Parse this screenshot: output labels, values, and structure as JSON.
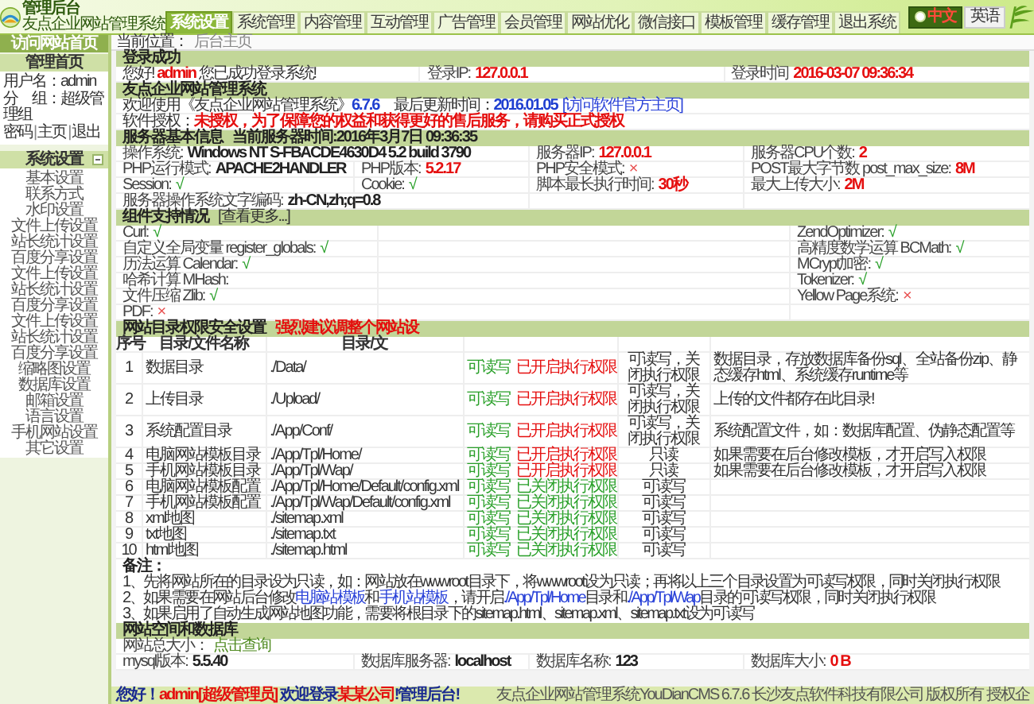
{
  "header": {
    "logo_title": "管理后台",
    "logo_subtitle": "友点企业网站管理系统",
    "nav": [
      {
        "label": "系统设置",
        "selected": true
      },
      {
        "label": "系统管理",
        "selected": false
      },
      {
        "label": "内容管理",
        "selected": false
      },
      {
        "label": "互动管理",
        "selected": false
      },
      {
        "label": "广告管理",
        "selected": false
      },
      {
        "label": "会员管理",
        "selected": false
      },
      {
        "label": "网站优化",
        "selected": false
      },
      {
        "label": "微信接口",
        "selected": false
      },
      {
        "label": "模板管理",
        "selected": false
      },
      {
        "label": "缓存管理",
        "selected": false
      },
      {
        "label": "退出系统",
        "selected": false
      }
    ],
    "languages": [
      {
        "label": "中文",
        "selected": true
      },
      {
        "label": "英语",
        "selected": false
      }
    ]
  },
  "sidebar": {
    "home_link": "访问网站首页",
    "panel_title": "管理首页",
    "user_lines": [
      "用户名：admin",
      "分　组：超级管理组"
    ],
    "links": [
      "密码",
      "主页",
      "退出"
    ],
    "separator": "|",
    "menu": {
      "title": "系统设置",
      "expanded": true,
      "items": [
        "基本设置",
        "联系方式",
        "水印设置",
        "文件上传设置",
        "站长统计设置",
        "百度分享设置",
        "文件上传设置",
        "站长统计设置",
        "百度分享设置",
        "文件上传设置",
        "站长统计设置",
        "百度分享设置",
        "缩略图设置",
        "数据库设置",
        "邮箱设置",
        "语言设置",
        "手机网站设置",
        "其它设置"
      ]
    }
  },
  "breadcrumb": {
    "label": "当前位置：",
    "items": [
      "后台主页"
    ]
  },
  "login": {
    "title": "登录成功",
    "greeting": [
      {
        "text": "您好! "
      },
      {
        "text": "admin",
        "kind": "red"
      },
      {
        "text": " 您已成功登录系统!"
      }
    ],
    "cells": [
      {
        "label": "登录IP:",
        "value": "127.0.0.1",
        "kind": "red"
      },
      {
        "label": "登录时间",
        "value": "2016-03-07 09:36:34",
        "kind": "red"
      }
    ]
  },
  "about": {
    "title": "友点企业网站管理系统",
    "lines": [
      [
        {
          "text": "欢迎使用《友点企业网站管理系统》"
        },
        {
          "text": "6.7.6",
          "kind": "blue"
        },
        {
          "text": "　最后更新时间："
        },
        {
          "text": "2016.01.05",
          "kind": "blue"
        },
        {
          "kind": "link",
          "text": "[访问软件官方主页]"
        }
      ],
      [
        {
          "text": "软件授权："
        },
        {
          "text": "未授权，为了保障您的权益和获得更好的售后服务，请购买正式授权",
          "kind": "red"
        }
      ]
    ]
  },
  "server": {
    "title": "服务器基本信息",
    "subtitle": "当前服务器时间:2016年3月7日 09:36:35",
    "rows": [
      [
        {
          "label": "操作系统:",
          "value": "Windows NT S-FBACDE4630D4 5.2 build 3790",
          "kind": "bold"
        },
        null,
        {
          "label": "服务器IP:",
          "value": "127.0.0.1",
          "kind": "red"
        },
        {
          "label": "服务器CPU个数:",
          "value": "2",
          "kind": "red"
        }
      ],
      [
        {
          "label": "PHP运行模式:",
          "value": "APACHE2HANDLER",
          "kind": "bold"
        },
        {
          "label": "PHP版本:",
          "value": "5.2.17",
          "kind": "red"
        },
        {
          "label": "PHP安全模式:",
          "value": "×",
          "kind": "bad"
        },
        {
          "label": "POST最大字节数 post_max_size:",
          "value": "8M",
          "kind": "red"
        }
      ],
      [
        {
          "label": "Session:",
          "value": "√",
          "kind": "ok"
        },
        {
          "label": "Cookie:",
          "value": "√",
          "kind": "ok"
        },
        {
          "label": "脚本最长执行时间:",
          "value": "30秒",
          "kind": "red"
        },
        {
          "label": "最大上传大小:",
          "value": "2M",
          "kind": "red"
        }
      ],
      [
        {
          "label": "服务器操作系统文字编码:",
          "value": "zh-CN,zh;q=0.8",
          "kind": "bold"
        },
        null,
        null,
        null
      ]
    ]
  },
  "components": {
    "title": "组件支持情况",
    "more_link": "[查看更多...]",
    "rows": [
      {
        "left": {
          "label": "Curl:",
          "value": "√",
          "kind": "ok"
        },
        "right": {
          "label": "ZendOptimizer:",
          "value": "√",
          "kind": "ok"
        }
      },
      {
        "left": {
          "label": "自定义全局变量 register_globals:",
          "value": "√",
          "kind": "ok"
        },
        "right": {
          "label": "高精度数学运算 BCMath:",
          "value": "√",
          "kind": "ok"
        }
      },
      {
        "left": {
          "label": "历法运算 Calendar:",
          "value": "√",
          "kind": "ok"
        },
        "right": {
          "label": "MCrypt加密:",
          "value": "√",
          "kind": "ok"
        }
      },
      {
        "left": {
          "label": "哈希计算 MHash:"
        },
        "right": {
          "label": "Tokenizer:",
          "value": "√",
          "kind": "ok"
        }
      },
      {
        "left": {
          "label": "文件压缩 Zlib:",
          "value": "√",
          "kind": "ok"
        },
        "right": {
          "label": "Yellow Page系统:",
          "value": "×",
          "kind": "bad"
        }
      },
      {
        "left": {
          "label": "PDF:",
          "value": "×",
          "kind": "bad"
        }
      }
    ]
  },
  "directories": {
    "title": "网站目录权限安全设置",
    "warning": "强烈建议调整个网站设",
    "columns": [
      "序号",
      "目录/文件名称",
      "目录/文"
    ],
    "rows": [
      {
        "num": "1",
        "name": "数据目录",
        "path": "./Data/",
        "access": "可读写",
        "exec": "已开启执行权限",
        "exec_enabled": true,
        "advice": "可读写，关闭执行权限",
        "desc": "数据目录，存放数据库备份sql、全站备份zip、静态缓存html、系统缓存runtime等"
      },
      {
        "num": "2",
        "name": "上传目录",
        "path": "./Upload/",
        "access": "可读写",
        "exec": "已开启执行权限",
        "exec_enabled": true,
        "advice": "可读写，关闭执行权限",
        "desc": "上传的文件都存在此目录!"
      },
      {
        "num": "3",
        "name": "系统配置目录",
        "path": "./App/Conf/",
        "access": "可读写",
        "exec": "已开启执行权限",
        "exec_enabled": true,
        "advice": "可读写，关闭执行权限",
        "desc": "系统配置文件，如：数据库配置、伪静态配置等"
      },
      {
        "num": "4",
        "name": "电脑网站模板目录",
        "path": "./App/Tpl/Home/",
        "access": "可读写",
        "exec": "已开启执行权限",
        "exec_enabled": true,
        "advice": "只读",
        "desc": "如果需要在后台修改模板，才开启写入权限"
      },
      {
        "num": "5",
        "name": "手机网站模板目录",
        "path": "./App/Tpl/Wap/",
        "access": "可读写",
        "exec": "已开启执行权限",
        "exec_enabled": true,
        "advice": "只读",
        "desc": "如果需要在后台修改模板，才开启写入权限"
      },
      {
        "num": "6",
        "name": "电脑网站模板配置",
        "path": "./App/Tpl/Home/Default/config.xml",
        "access": "可读写",
        "exec": "已关闭执行权限",
        "exec_enabled": false,
        "advice": "可读写"
      },
      {
        "num": "7",
        "name": "手机网站模板配置",
        "path": "./App/Tpl/Wap/Default/config.xml",
        "access": "可读写",
        "exec": "已关闭执行权限",
        "exec_enabled": false,
        "advice": "可读写"
      },
      {
        "num": "8",
        "name": "xml地图",
        "path": "./sitemap.xml",
        "access": "可读写",
        "exec": "已关闭执行权限",
        "exec_enabled": false,
        "advice": "可读写"
      },
      {
        "num": "9",
        "name": "txt地图",
        "path": "./sitemap.txt",
        "access": "可读写",
        "exec": "已关闭执行权限",
        "exec_enabled": false,
        "advice": "可读写"
      },
      {
        "num": "10",
        "name": "html地图",
        "path": "./sitemap.html",
        "access": "可读写",
        "exec": "已关闭执行权限",
        "exec_enabled": false,
        "advice": "可读写"
      }
    ],
    "notes_title": "备注：",
    "notes": [
      [
        {
          "text": "1、先将网站所在的目录设为只读，如：网站放在wwwroot目录下，将wwwroot设为只读；再将以上三个目录设置为可读写权限，同时关闭执行权限"
        }
      ],
      [
        {
          "text": "2、如果需要在网站后台修改"
        },
        {
          "kind": "link",
          "text": "电脑站模板"
        },
        {
          "text": "和"
        },
        {
          "kind": "link",
          "text": "手机站模板"
        },
        {
          "text": "，请开启"
        },
        {
          "kind": "link",
          "text": "./App/Tpl/Home"
        },
        {
          "text": "目录和"
        },
        {
          "kind": "link",
          "text": "./App/Tpl/Wap"
        },
        {
          "text": "目录的可读写权限，同时关闭执行权限"
        }
      ],
      [
        {
          "text": "3、如果启用了自动生成网站地图功能，需要将根目录下的sitemap.html、sitemap.xml、sitemap.txt设为可读写"
        }
      ]
    ]
  },
  "space": {
    "title": "网站空间和数据库",
    "size_label": "网站总大小：",
    "size_link": "点击查询",
    "rows": [
      [
        {
          "label": "mysql版本:",
          "value": "5.5.40",
          "kind": "bold"
        },
        {
          "label": "数据库服务器:",
          "value": "localhost",
          "kind": "bold"
        },
        {
          "label": "数据库名称:",
          "value": "123",
          "kind": "bold"
        },
        {
          "label": "数据库大小:",
          "value": "0 B",
          "kind": "red"
        }
      ]
    ]
  },
  "footer": {
    "greeting": [
      {
        "text": "您好！",
        "kind": "navy"
      },
      {
        "text": "admin[超级管理员]",
        "kind": "red"
      },
      {
        "text": " 欢迎登录",
        "kind": "navy"
      },
      {
        "text": "某某公司",
        "kind": "red"
      },
      {
        "text": "!管理后台!",
        "kind": "navy"
      }
    ],
    "copyright": "友点企业网站管理系统YouDianCMS 6.7.6 长沙友点软件科技有限公司 版权所有 授权企"
  }
}
